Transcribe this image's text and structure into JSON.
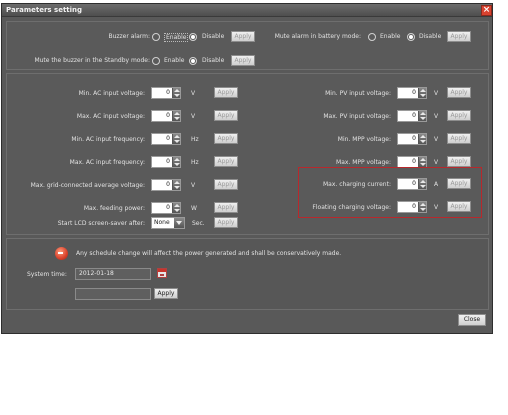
{
  "window": {
    "title": "Parameters setting"
  },
  "top": {
    "buzzer": {
      "label": "Buzzer alarm:",
      "enable": "Enable",
      "disable": "Disable",
      "apply": "Apply"
    },
    "mute_battery": {
      "label": "Mute alarm in battery mode:",
      "enable": "Enable",
      "disable": "Disable",
      "apply": "Apply"
    },
    "mute_standby": {
      "label": "Mute the buzzer in the Standby mode:",
      "enable": "Enable",
      "disable": "Disable",
      "apply": "Apply"
    }
  },
  "left_params": [
    {
      "label": "Min. AC input voltage:",
      "value": "0",
      "unit": "V",
      "apply": "Apply"
    },
    {
      "label": "Max. AC input voltage:",
      "value": "0",
      "unit": "V",
      "apply": "Apply"
    },
    {
      "label": "Min. AC input frequency:",
      "value": "0",
      "unit": "Hz",
      "apply": "Apply"
    },
    {
      "label": "Max. AC input frequency:",
      "value": "0",
      "unit": "Hz",
      "apply": "Apply"
    },
    {
      "label": "Max. grid-connected average voltage:",
      "value": "0",
      "unit": "V",
      "apply": "Apply"
    },
    {
      "label": "Max. feeding power:",
      "value": "0",
      "unit": "W",
      "apply": "Apply"
    }
  ],
  "screensaver": {
    "label": "Start LCD screen-saver after:",
    "value": "None",
    "unit": "Sec.",
    "apply": "Apply"
  },
  "right_params": [
    {
      "label": "Min. PV input voltage:",
      "value": "0",
      "unit": "V",
      "apply": "Apply"
    },
    {
      "label": "Max. PV input voltage:",
      "value": "0",
      "unit": "V",
      "apply": "Apply"
    },
    {
      "label": "Min. MPP voltage:",
      "value": "0",
      "unit": "V",
      "apply": "Apply"
    },
    {
      "label": "Max. MPP voltage:",
      "value": "0",
      "unit": "V",
      "apply": "Apply"
    },
    {
      "label": "Max. charging current:",
      "value": "0",
      "unit": "A",
      "apply": "Apply"
    },
    {
      "label": "Floating charging voltage:",
      "value": "0",
      "unit": "V",
      "apply": "Apply"
    }
  ],
  "schedule": {
    "notice": "Any schedule change will affect the power generated and shall be conservatively made.",
    "system_time_label": "System time:",
    "system_time_value": "2012-01-18",
    "extra_value": "",
    "apply": "Apply"
  },
  "footer": {
    "close": "Close"
  },
  "colors": {
    "highlight_border": "#b8282c",
    "warning_icon": "#d9402a"
  }
}
